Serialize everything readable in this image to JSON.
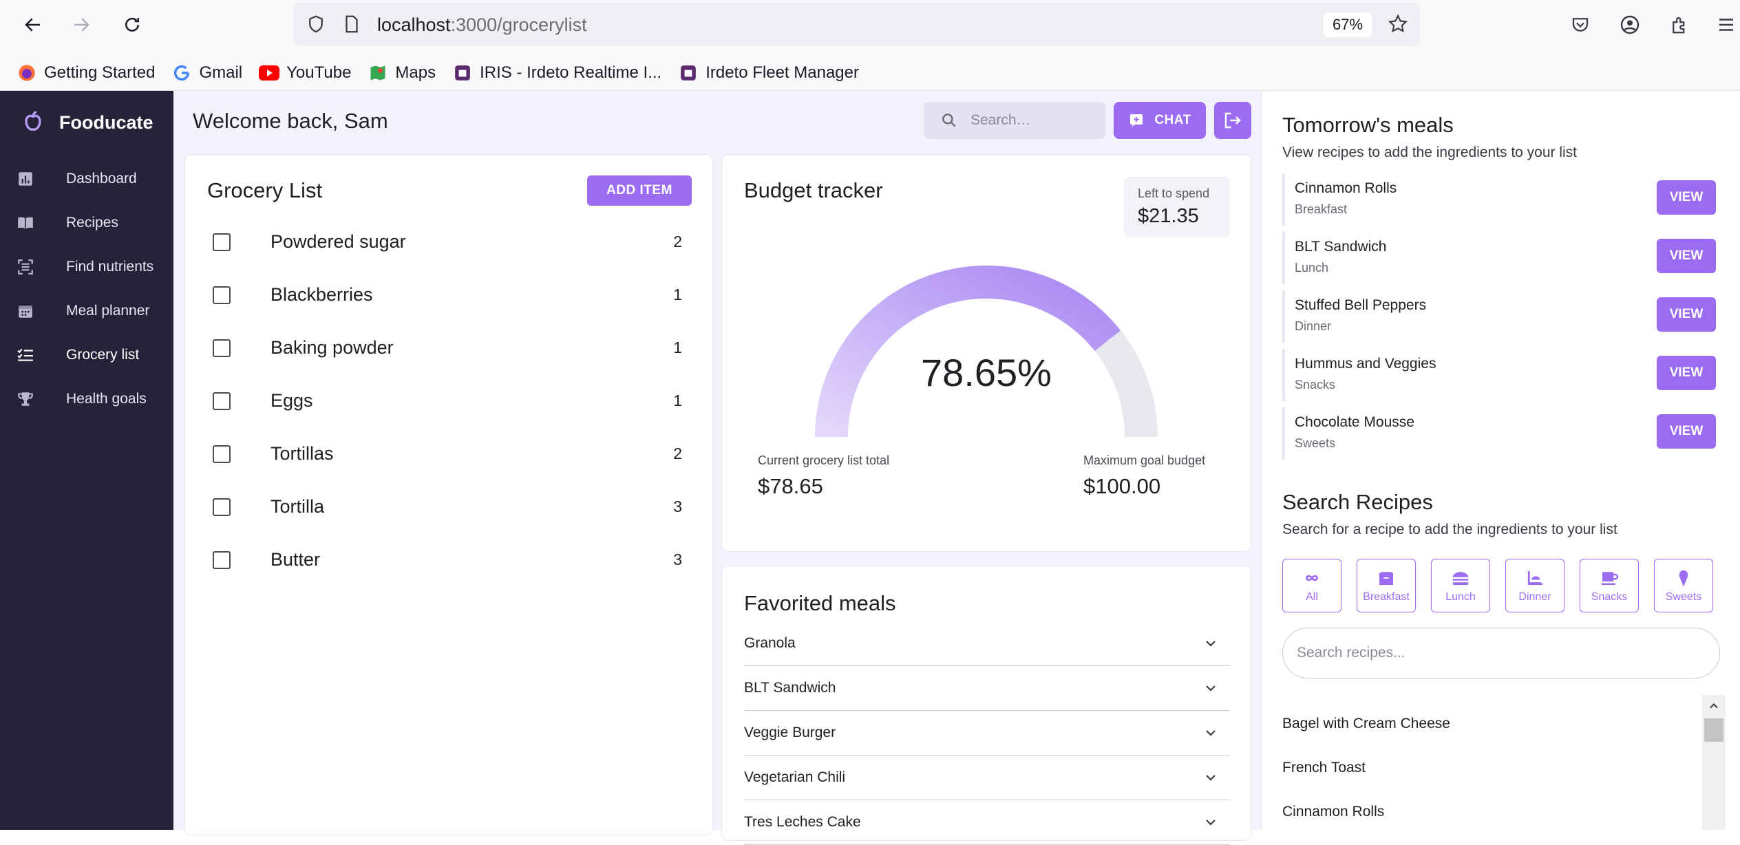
{
  "browser": {
    "url_host": "localhost",
    "url_path": ":3000/grocerylist",
    "zoom": "67%",
    "bookmarks": [
      "Getting Started",
      "Gmail",
      "YouTube",
      "Maps",
      "IRIS - Irdeto Realtime I...",
      "Irdeto Fleet Manager"
    ]
  },
  "sidebar": {
    "brand": "Fooducate",
    "items": [
      {
        "label": "Dashboard",
        "icon": "chart-icon"
      },
      {
        "label": "Recipes",
        "icon": "book-icon"
      },
      {
        "label": "Find nutrients",
        "icon": "scan-icon"
      },
      {
        "label": "Meal planner",
        "icon": "calendar-icon"
      },
      {
        "label": "Grocery list",
        "icon": "checklist-icon"
      },
      {
        "label": "Health goals",
        "icon": "trophy-icon"
      }
    ]
  },
  "header": {
    "welcome": "Welcome back, Sam",
    "search_placeholder": "Search…",
    "chat_label": "CHAT"
  },
  "grocery": {
    "title": "Grocery List",
    "add_label": "ADD ITEM",
    "items": [
      {
        "name": "Powdered sugar",
        "qty": "2"
      },
      {
        "name": "Blackberries",
        "qty": "1"
      },
      {
        "name": "Baking powder",
        "qty": "1"
      },
      {
        "name": "Eggs",
        "qty": "1"
      },
      {
        "name": "Tortillas",
        "qty": "2"
      },
      {
        "name": "Tortilla",
        "qty": "3"
      },
      {
        "name": "Butter",
        "qty": "3"
      }
    ]
  },
  "budget": {
    "title": "Budget tracker",
    "left_label": "Left to spend",
    "left_value": "$21.35",
    "percent_text": "78.65%",
    "percent_value": 78.65,
    "current_label": "Current grocery list total",
    "current_value": "$78.65",
    "max_label": "Maximum goal budget",
    "max_value": "$100.00"
  },
  "favorites": {
    "title": "Favorited meals",
    "items": [
      "Granola",
      "BLT Sandwich",
      "Veggie Burger",
      "Vegetarian Chili",
      "Tres Leches Cake"
    ]
  },
  "tomorrow": {
    "title": "Tomorrow's meals",
    "subtitle": "View recipes to add the ingredients to your list",
    "view_label": "VIEW",
    "meals": [
      {
        "name": "Cinnamon Rolls",
        "type": "Breakfast"
      },
      {
        "name": "BLT Sandwich",
        "type": "Lunch"
      },
      {
        "name": "Stuffed Bell Peppers",
        "type": "Dinner"
      },
      {
        "name": "Hummus and Veggies",
        "type": "Snacks"
      },
      {
        "name": "Chocolate Mousse",
        "type": "Sweets"
      }
    ]
  },
  "search_recipes": {
    "title": "Search Recipes",
    "subtitle": "Search for a recipe to add the ingredients to your list",
    "categories": [
      "All",
      "Breakfast",
      "Lunch",
      "Dinner",
      "Snacks",
      "Sweets"
    ],
    "placeholder": "Search recipes...",
    "results": [
      "Bagel with Cream Cheese",
      "French Toast",
      "Cinnamon Rolls"
    ]
  },
  "colors": {
    "accent": "#9b6cf2",
    "sidebar": "#25223a",
    "main_bg": "#f3f2ff"
  }
}
